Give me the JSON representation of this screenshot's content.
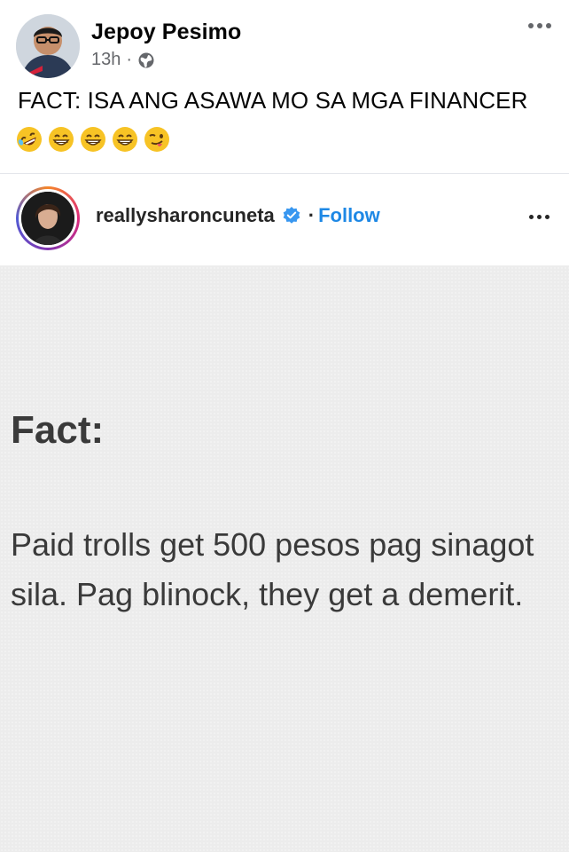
{
  "post": {
    "author": "Jepoy Pesimo",
    "time": "13h",
    "separator": "·",
    "text": "FACT: ISA ANG ASAWA MO SA MGA FINANCER",
    "emojis": [
      "rolling-on-floor-laughing-emoji",
      "grinning-face-emoji",
      "grinning-face-emoji",
      "grinning-face-emoji",
      "winking-tongue-face-emoji"
    ]
  },
  "shared": {
    "username": "reallysharoncuneta",
    "follow_separator": "·",
    "follow_label": "Follow",
    "title": "Fact:",
    "body": "Paid trolls get 500 pesos pag sinagot sila. Pag blinock, they get a demerit."
  },
  "colors": {
    "meta_gray": "#65676b",
    "follow_blue": "#1e88e5",
    "verified_blue": "#3897f0",
    "ig_background": "#ececec"
  }
}
